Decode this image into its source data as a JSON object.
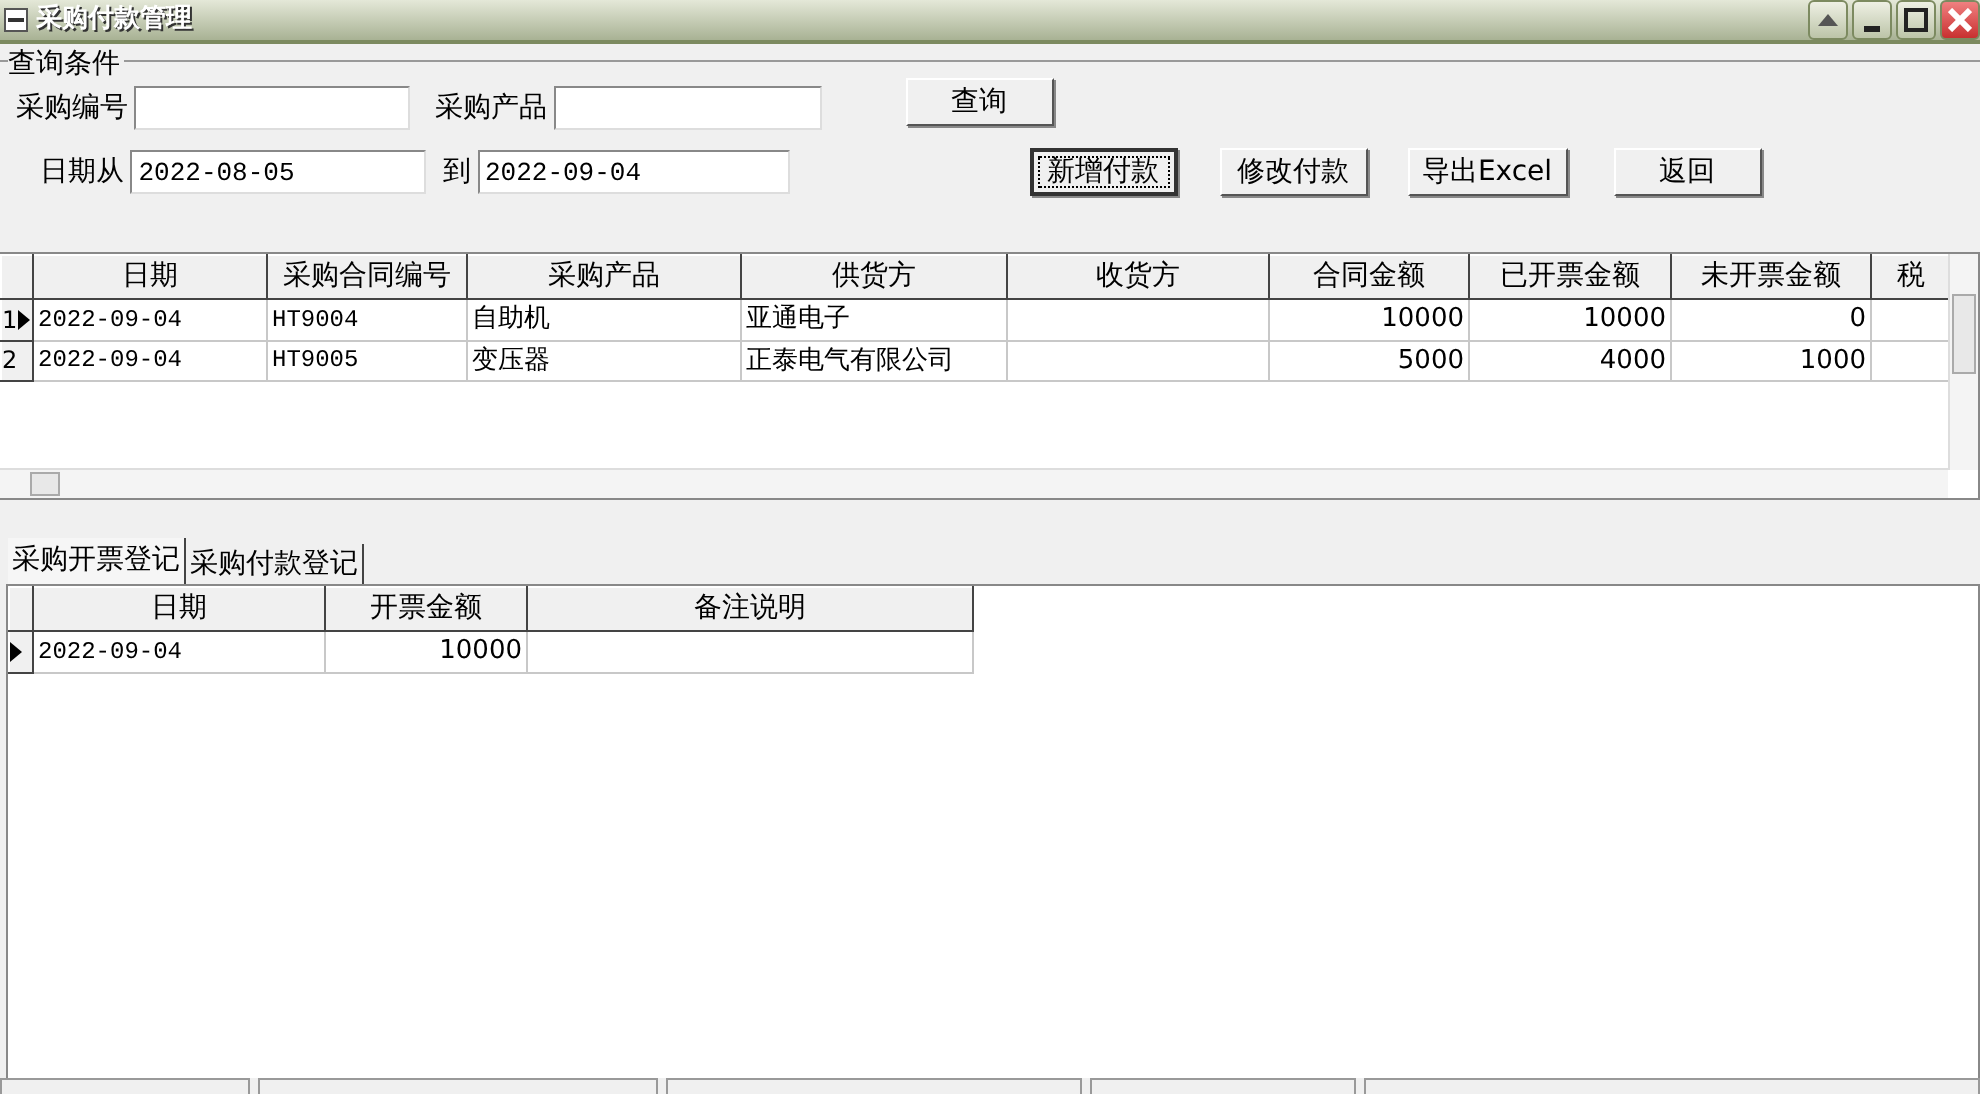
{
  "window": {
    "title": "采购付款管理"
  },
  "query": {
    "title": "查询条件",
    "fields": [
      {
        "label": "采购编号"
      },
      {
        "label": "采购产品"
      },
      {
        "label": "日期从",
        "value": "2022-08-05"
      },
      {
        "label": "到",
        "value": "2022-09-04"
      }
    ],
    "search_button": "查询",
    "buttons": [
      {
        "label": "新增付款",
        "focused": true
      },
      {
        "label": "修改付款",
        "focused": false
      },
      {
        "label": "导出Excel",
        "focused": false
      },
      {
        "label": "返回",
        "focused": false
      }
    ]
  },
  "contracts": {
    "columns": [
      "日期",
      "采购合同编号",
      "采购产品",
      "供货方",
      "收货方",
      "合同金额",
      "已开票金额",
      "未开票金额",
      "税"
    ],
    "rows": [
      {
        "number": "1",
        "selected": true,
        "cells": [
          "2022-09-04",
          "HT9004",
          "自助机",
          "亚通电子",
          "",
          "10000",
          "10000",
          "0",
          ""
        ]
      },
      {
        "number": "2",
        "selected": false,
        "cells": [
          "2022-09-04",
          "HT9005",
          "变压器",
          "正泰电气有限公司",
          "",
          "5000",
          "4000",
          "1000",
          ""
        ]
      }
    ]
  },
  "tabs": [
    {
      "label": "采购开票登记",
      "selected": true
    },
    {
      "label": "采购付款登记",
      "selected": false
    }
  ],
  "invoices": {
    "columns": [
      "日期",
      "开票金额",
      "备注说明"
    ],
    "rows": [
      {
        "selected": true,
        "cells": [
          "2022-09-04",
          "10000",
          ""
        ]
      }
    ]
  }
}
